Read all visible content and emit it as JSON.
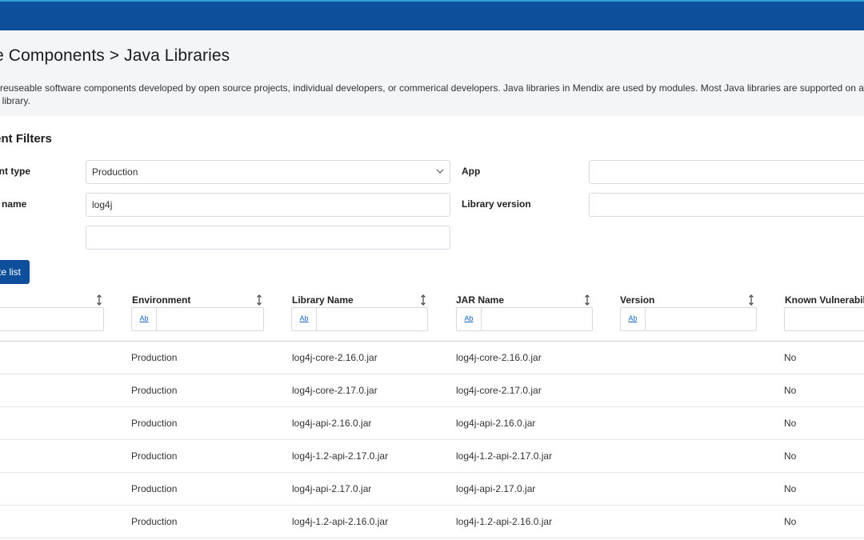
{
  "header": {
    "title": "re Components > Java Libraries",
    "description_line1": "re reuseable software components developed by open source projects, individual developers, or commerical developers. Java libraries in Mendix are used by modules. Most Java libraries are supported on a best-effort",
    "description_line2": "he library."
  },
  "filters": {
    "title": "nent Filters",
    "environment_type": {
      "label": "ent type",
      "value": "Production"
    },
    "app": {
      "label": "App",
      "value": ""
    },
    "library_name": {
      "label": "y name",
      "value": "log4j"
    },
    "library_version": {
      "label": "Library version",
      "value": ""
    },
    "third_field": {
      "value": ""
    },
    "update_button": "te list"
  },
  "table": {
    "columns": [
      {
        "label": "Environment"
      },
      {
        "label": "Library Name"
      },
      {
        "label": "JAR Name"
      },
      {
        "label": "Version"
      },
      {
        "label": "Known Vulnerabilit"
      }
    ],
    "filter_button": "Ab",
    "rows": [
      {
        "environment": "Production",
        "library": "log4j-core-2.16.0.jar",
        "jar": "log4j-core-2.16.0.jar",
        "version": "",
        "vuln": "No"
      },
      {
        "environment": "Production",
        "library": "log4j-core-2.17.0.jar",
        "jar": "log4j-core-2.17.0.jar",
        "version": "",
        "vuln": "No"
      },
      {
        "environment": "Production",
        "library": "log4j-api-2.16.0.jar",
        "jar": "log4j-api-2.16.0.jar",
        "version": "",
        "vuln": "No"
      },
      {
        "environment": "Production",
        "library": "log4j-1.2-api-2.17.0.jar",
        "jar": "log4j-1.2-api-2.17.0.jar",
        "version": "",
        "vuln": "No"
      },
      {
        "environment": "Production",
        "library": "log4j-api-2.17.0.jar",
        "jar": "log4j-api-2.17.0.jar",
        "version": "",
        "vuln": "No"
      },
      {
        "environment": "Production",
        "library": "log4j-1.2-api-2.16.0.jar",
        "jar": "log4j-1.2-api-2.16.0.jar",
        "version": "",
        "vuln": "No"
      }
    ]
  },
  "colors": {
    "brand": "#0e4f9b",
    "accent": "#31a3d6",
    "link": "#1565c0"
  }
}
